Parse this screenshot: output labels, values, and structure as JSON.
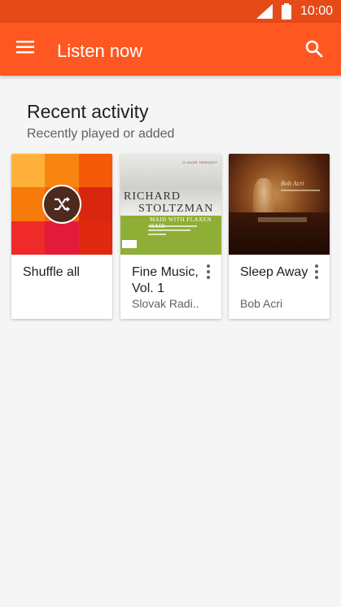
{
  "status_bar": {
    "time": "10:00",
    "icons": [
      "signal-icon",
      "battery-icon"
    ]
  },
  "app_bar": {
    "title": "Listen now",
    "menu_icon": "menu-icon",
    "search_icon": "search-icon"
  },
  "recent": {
    "title": "Recent activity",
    "subtitle": "Recently played or added"
  },
  "cards": [
    {
      "title": "Shuffle all",
      "subtitle": ""
    },
    {
      "title": "Fine Music, Vol. 1",
      "subtitle": "Slovak Radi..",
      "art_text": {
        "label": "CLAUDE DEBUSSY",
        "artist_line1": "RICHARD",
        "artist_line2": "STOLTZMAN",
        "work": "MAID WITH FLAXEN HAIR"
      }
    },
    {
      "title": "Sleep Away",
      "subtitle": "Bob Acri",
      "art_text": {
        "script": "Bob Acri"
      }
    }
  ],
  "colors": {
    "accent": "#ff5722",
    "status": "#e64a19",
    "background": "#f5f5f5"
  }
}
